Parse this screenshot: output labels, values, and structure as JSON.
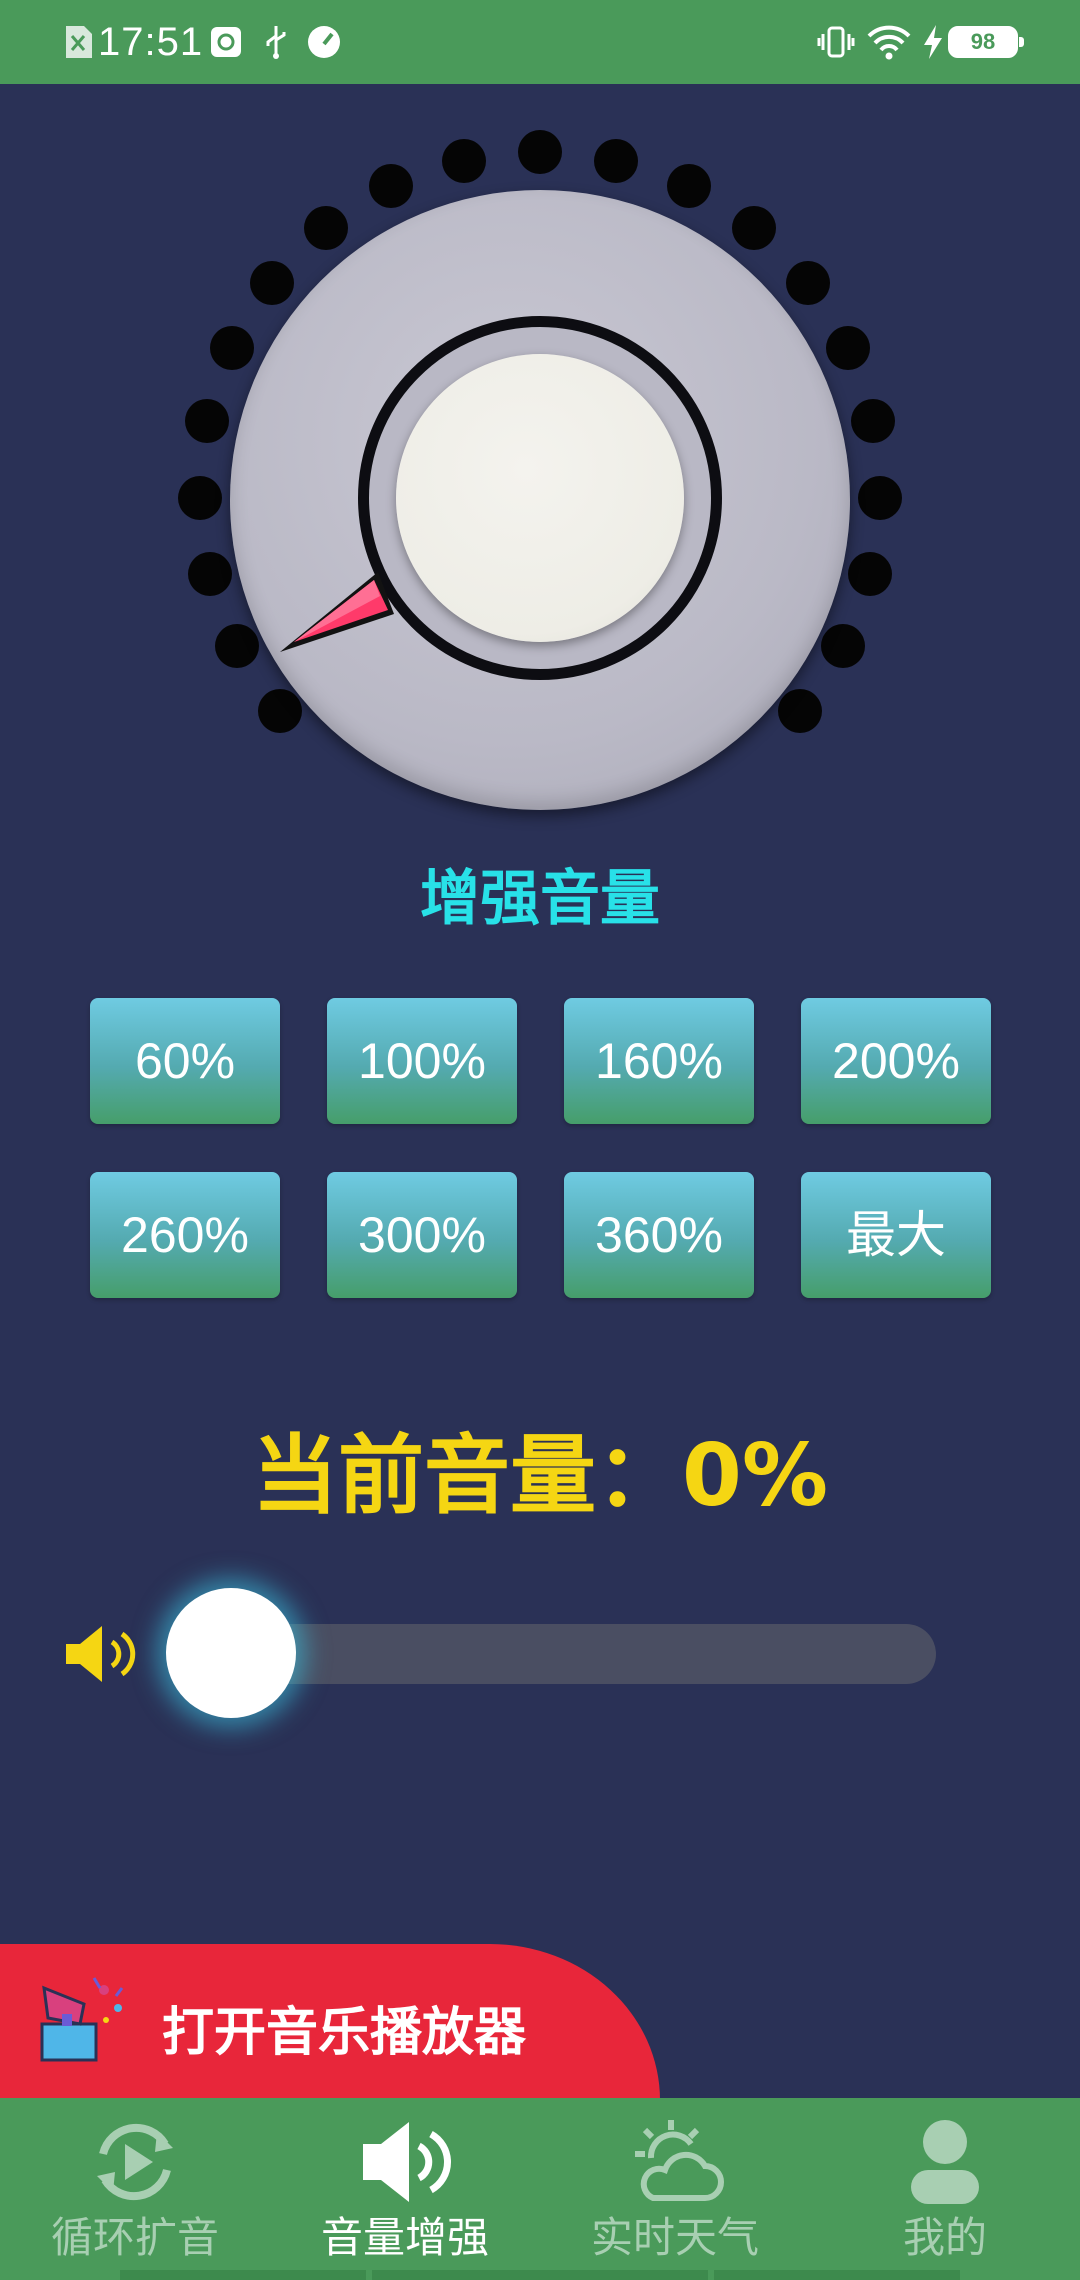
{
  "status_bar": {
    "time": "17:51",
    "battery": "98"
  },
  "knob": {
    "title": "增强音量"
  },
  "presets": [
    {
      "label": "60%"
    },
    {
      "label": "100%"
    },
    {
      "label": "160%"
    },
    {
      "label": "200%"
    },
    {
      "label": "260%"
    },
    {
      "label": "300%"
    },
    {
      "label": "360%"
    },
    {
      "label": "最大"
    }
  ],
  "current_volume": {
    "text": "当前音量：0%",
    "level_percent": 0
  },
  "music_player": {
    "label": "打开音乐播放器"
  },
  "bottom_nav": {
    "items": [
      {
        "label": "循环扩音",
        "icon": "loop-play-icon"
      },
      {
        "label": "音量增强",
        "icon": "speaker-icon",
        "active": true
      },
      {
        "label": "实时天气",
        "icon": "weather-icon"
      },
      {
        "label": "我的",
        "icon": "user-icon"
      }
    ]
  },
  "colors": {
    "background": "#2a3156",
    "bars": "#4a9a5a",
    "title": "#28e1e8",
    "volume_text": "#f5d613",
    "banner": "#e8263a"
  }
}
